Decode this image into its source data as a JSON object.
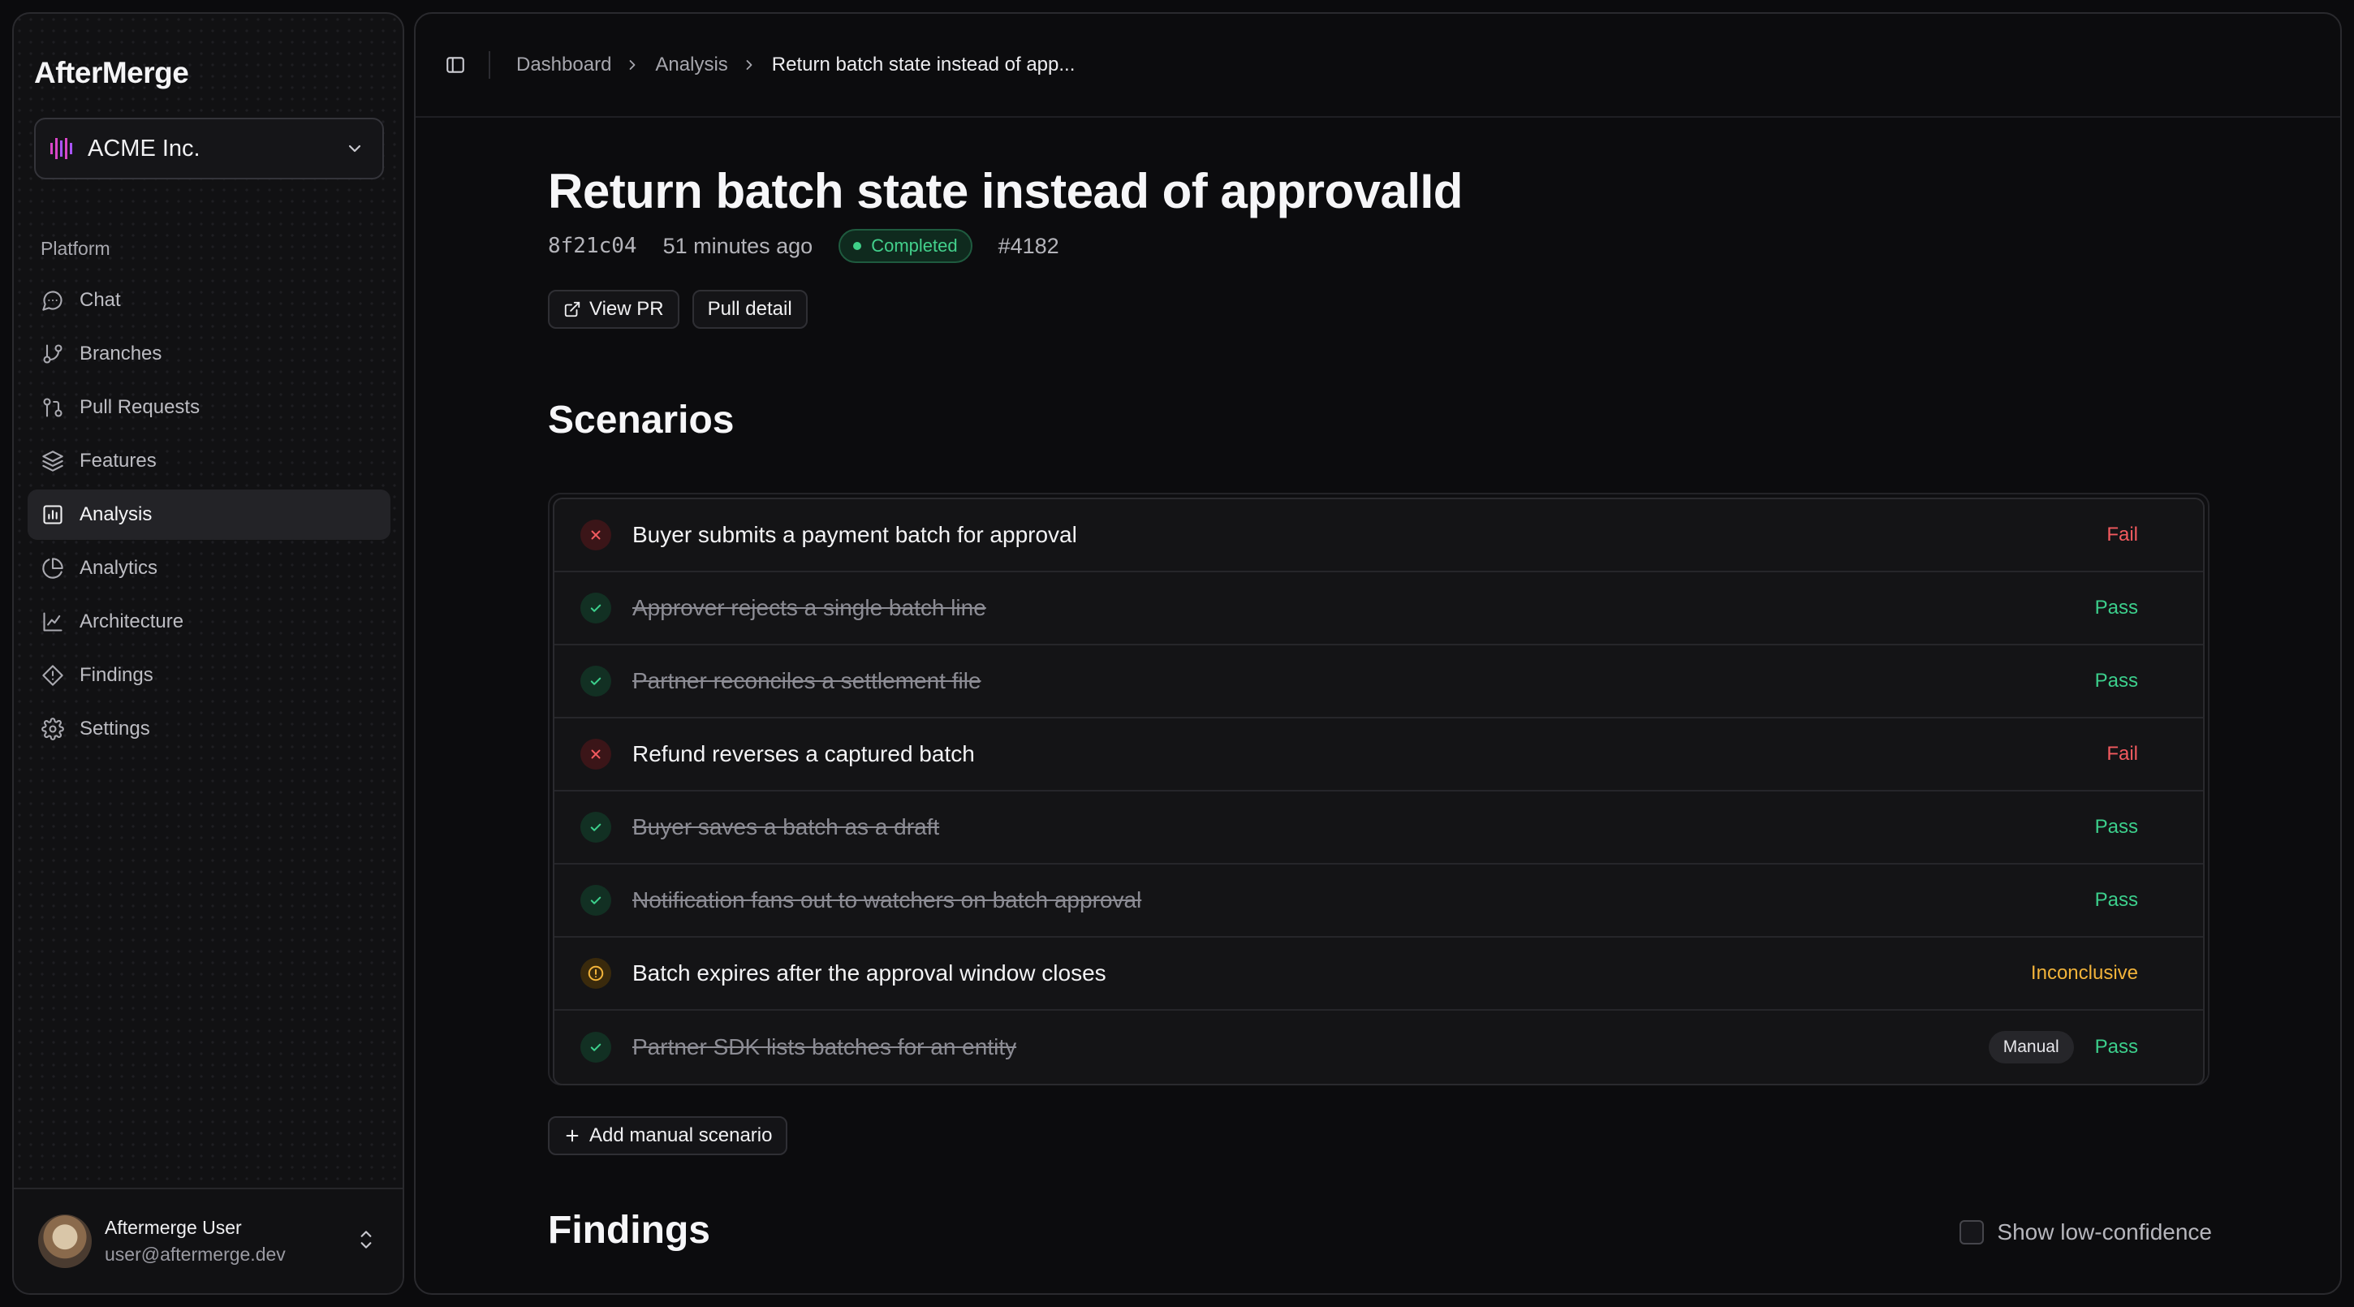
{
  "app": {
    "name": "AfterMerge"
  },
  "org_selector": {
    "name": "ACME Inc.",
    "logo_icon": "org-logo-icon",
    "accent": "#d946c8"
  },
  "sidebar": {
    "group_label": "Platform",
    "items": [
      {
        "label": "Chat",
        "icon": "chat-icon",
        "active": false
      },
      {
        "label": "Branches",
        "icon": "branch-icon",
        "active": false
      },
      {
        "label": "Pull Requests",
        "icon": "pull-request-icon",
        "active": false
      },
      {
        "label": "Features",
        "icon": "layers-icon",
        "active": false
      },
      {
        "label": "Analysis",
        "icon": "bar-chart-icon",
        "active": true
      },
      {
        "label": "Analytics",
        "icon": "pie-chart-icon",
        "active": false
      },
      {
        "label": "Architecture",
        "icon": "line-chart-icon",
        "active": false
      },
      {
        "label": "Findings",
        "icon": "alert-octagon-icon",
        "active": false
      },
      {
        "label": "Settings",
        "icon": "gear-icon",
        "active": false
      }
    ]
  },
  "user": {
    "name": "Aftermerge User",
    "email": "user@aftermerge.dev"
  },
  "breadcrumb": {
    "items": [
      "Dashboard",
      "Analysis"
    ],
    "current": "Return batch state instead of app..."
  },
  "analysis": {
    "title": "Return batch state instead of approvalId",
    "commit_sha": "8f21c04",
    "time_ago": "51 minutes ago",
    "status": "Completed",
    "pr_number": "#4182",
    "view_pr_label": "View PR",
    "pull_detail_label": "Pull detail"
  },
  "scenarios": {
    "heading": "Scenarios",
    "items": [
      {
        "label": "Buyer submits a payment batch for approval",
        "result": "Fail",
        "status": "fail",
        "manual": false
      },
      {
        "label": "Approver rejects a single batch line",
        "result": "Pass",
        "status": "pass",
        "manual": false
      },
      {
        "label": "Partner reconciles a settlement file",
        "result": "Pass",
        "status": "pass",
        "manual": false
      },
      {
        "label": "Refund reverses a captured batch",
        "result": "Fail",
        "status": "fail",
        "manual": false
      },
      {
        "label": "Buyer saves a batch as a draft",
        "result": "Pass",
        "status": "pass",
        "manual": false
      },
      {
        "label": "Notification fans out to watchers on batch approval",
        "result": "Pass",
        "status": "pass",
        "manual": false
      },
      {
        "label": "Batch expires after the approval window closes",
        "result": "Inconclusive",
        "status": "inconclusive",
        "manual": false
      },
      {
        "label": "Partner SDK lists batches for an entity",
        "result": "Pass",
        "status": "pass",
        "manual": true
      }
    ],
    "manual_tag": "Manual",
    "add_label": "Add manual scenario"
  },
  "findings": {
    "heading": "Findings",
    "show_low_confidence_label": "Show low-confidence",
    "show_low_confidence_checked": false
  },
  "colors": {
    "fail": "#f25a5f",
    "pass": "#3ccf8c",
    "inconclusive": "#f2b33a",
    "completed": "#43d08c"
  }
}
